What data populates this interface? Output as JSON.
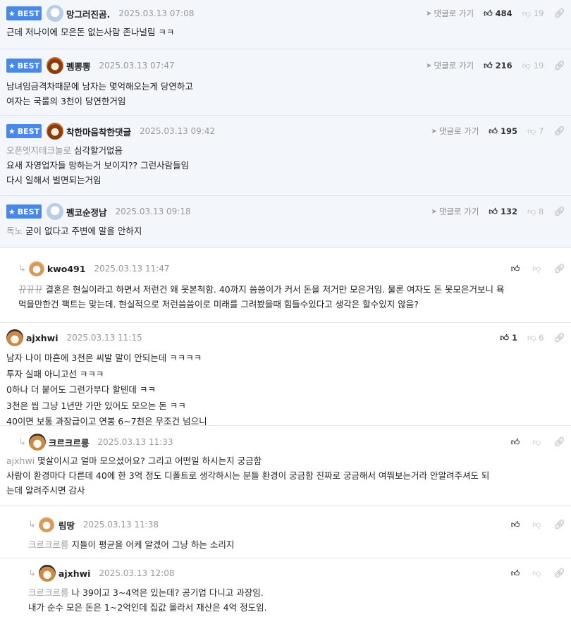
{
  "ui": {
    "best_label": "BEST",
    "goto_label": "댓글로 가기"
  },
  "comments": [
    {
      "id": "c1",
      "best": true,
      "nick": "망그러진곰.",
      "date": "2025.03.13 07:08",
      "likes": "484",
      "dislikes": "19",
      "mention": "",
      "lines": [
        "근데 저나이에 모은돈 없는사람 존나널림 ㅋㅋ"
      ]
    },
    {
      "id": "c2",
      "best": true,
      "nick": "펨뽕뽕",
      "date": "2025.03.13 07:47",
      "likes": "216",
      "dislikes": "19",
      "mention": "",
      "lines": [
        "남녀임금격차때문에 남자는 몇억해오는게 당연하고",
        "여자는 국룰의 3천이 당연한거임"
      ]
    },
    {
      "id": "c3",
      "best": true,
      "nick": "착한마음착한댓글",
      "date": "2025.03.13 09:42",
      "likes": "195",
      "dislikes": "7",
      "mention": "오픈엣지테크놀로",
      "lines": [
        "심각할거없음",
        "요새 자영업자들 망하는거 보이지?? 그런사람들임",
        "다시 일해서 벌면되는거임"
      ]
    },
    {
      "id": "c4",
      "best": true,
      "nick": "펨코순정남",
      "date": "2025.03.13 09:18",
      "likes": "132",
      "dislikes": "8",
      "mention": "독노",
      "lines": [
        "굳이 없다고 주변에 말을 안하지"
      ]
    },
    {
      "id": "c5",
      "best": false,
      "nick": "kwo491",
      "date": "2025.03.13 11:47",
      "likes": "",
      "dislikes": "",
      "mention": "뀨뀨뀨",
      "lines": [
        "결혼은 현실이라고 하면서 저런건 왜 못본척함. 40까지 씀씀이가 커서 돈을 저거만 모은거임. 물론 여자도 돈 못모은거보니 욕",
        "먹을만한건 팩트는 맞는데. 현실적으로 저런씀씀이로 미래를 그려봤을때 힘들수있다고 생각은 할수있지 않음?"
      ]
    },
    {
      "id": "c6",
      "best": false,
      "nick": "ajxhwi",
      "date": "2025.03.13 11:15",
      "likes": "1",
      "dislikes": "6",
      "mention": "",
      "lines": [
        "남자 나이 마흔에 3천은 씨발 말이 안되는데 ㅋㅋㅋㅋ",
        "투자 실패 아니고선 ㅋㅋㅋ",
        "0하나 더 붙어도 그런가부다 할텐데 ㅋㅋ",
        "3천은 씹 그냥 1년만 가만 있어도 모으는 돈 ㅋㅋ",
        "40이면 보통 과장급이고 연봉 6~7천은 무조건 넘으니"
      ]
    },
    {
      "id": "c7",
      "best": false,
      "nick": "크르크르릉",
      "date": "2025.03.13 11:33",
      "likes": "",
      "dislikes": "",
      "mention": "ajxhwi",
      "lines": [
        "몇살이시고 얼마 모으셨어요? 그리고 어떤일 하시는지 궁금함",
        "사람이 환경마다 다른데 40에 한 3억 정도 디폴트로 생각하시는 분들 환경이 궁금함 진짜로 궁금해서 여쭤보는거라 안알려주셔도 되",
        "는데 알려주시면 감사"
      ]
    },
    {
      "id": "c8",
      "best": false,
      "nick": "림땅",
      "date": "2025.03.13 11:38",
      "likes": "",
      "dislikes": "",
      "mention": "크르크르릉",
      "lines": [
        "지들이 평균을 어케 알겠어 그냥 하는 소리지"
      ]
    },
    {
      "id": "c9",
      "best": false,
      "nick": "ajxhwi",
      "date": "2025.03.13 12:08",
      "likes": "",
      "dislikes": "",
      "mention": "크르크르릉",
      "lines": [
        "나 39이고 3~4억은 있는데? 공기업 다니고 과장임.",
        "내가 순수 모은 돈은 1~2억인데 집값 올라서 재산은 4억 정도임."
      ]
    }
  ]
}
